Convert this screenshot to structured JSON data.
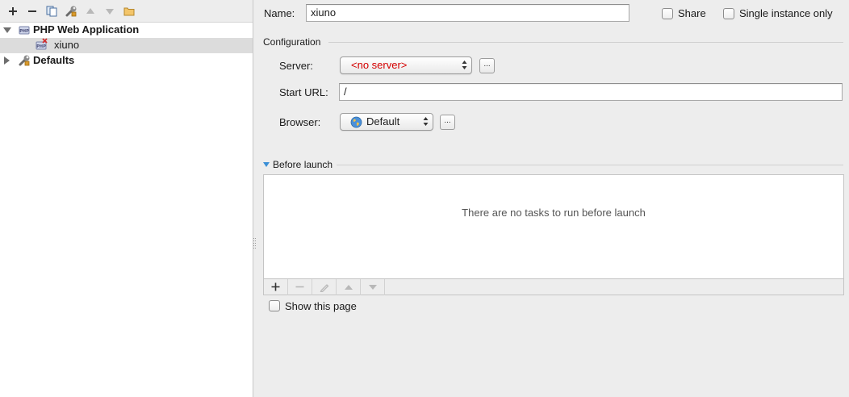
{
  "toolbar": {
    "icons": [
      "plus-icon",
      "minus-icon",
      "copy-icon",
      "wrench-icon",
      "arrow-up-icon",
      "arrow-down-icon",
      "folder-icon"
    ]
  },
  "tree": {
    "items": [
      {
        "label": "PHP Web Application",
        "icon": "php-icon",
        "expanded": true
      },
      {
        "label": "xiuno",
        "icon": "php-error-icon",
        "selected": true
      },
      {
        "label": "Defaults",
        "icon": "wrench-icon",
        "expanded": false
      }
    ]
  },
  "form": {
    "name_label": "Name:",
    "name_value": "xiuno",
    "share_label": "Share",
    "single_instance_label": "Single instance only",
    "configuration_title": "Configuration",
    "server_label": "Server:",
    "server_value": "<no server>",
    "start_url_label": "Start URL:",
    "start_url_value": "/",
    "browser_label": "Browser:",
    "browser_value": "Default",
    "ellipsis": "..."
  },
  "before_launch": {
    "title": "Before launch",
    "empty_text": "There are no tasks to run before launch",
    "toolbar_icons": [
      "plus-icon",
      "minus-icon",
      "pencil-icon",
      "arrow-up-icon",
      "arrow-down-icon"
    ]
  },
  "show_page": {
    "label": "Show this page"
  },
  "colors": {
    "no_server_text": "#d40000",
    "selection": "#dcdcdc",
    "background": "#ededed"
  }
}
